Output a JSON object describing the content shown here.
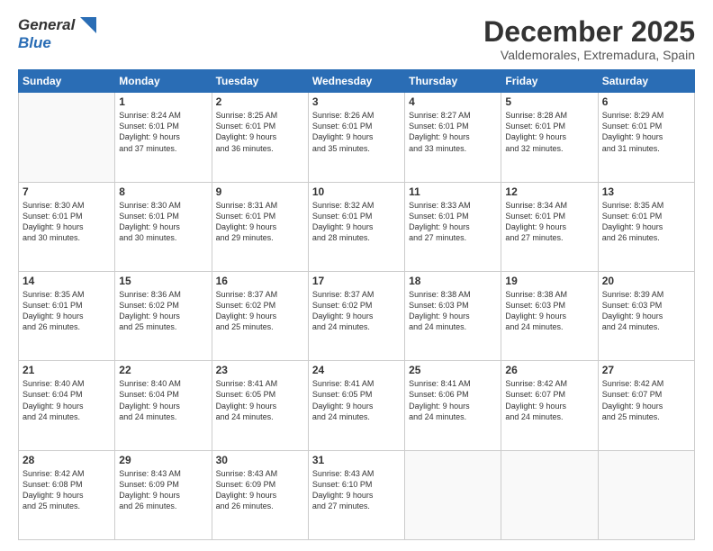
{
  "header": {
    "logo_general": "General",
    "logo_blue": "Blue",
    "month_title": "December 2025",
    "subtitle": "Valdemorales, Extremadura, Spain"
  },
  "days_of_week": [
    "Sunday",
    "Monday",
    "Tuesday",
    "Wednesday",
    "Thursday",
    "Friday",
    "Saturday"
  ],
  "weeks": [
    [
      {
        "day": "",
        "info": ""
      },
      {
        "day": "1",
        "info": "Sunrise: 8:24 AM\nSunset: 6:01 PM\nDaylight: 9 hours\nand 37 minutes."
      },
      {
        "day": "2",
        "info": "Sunrise: 8:25 AM\nSunset: 6:01 PM\nDaylight: 9 hours\nand 36 minutes."
      },
      {
        "day": "3",
        "info": "Sunrise: 8:26 AM\nSunset: 6:01 PM\nDaylight: 9 hours\nand 35 minutes."
      },
      {
        "day": "4",
        "info": "Sunrise: 8:27 AM\nSunset: 6:01 PM\nDaylight: 9 hours\nand 33 minutes."
      },
      {
        "day": "5",
        "info": "Sunrise: 8:28 AM\nSunset: 6:01 PM\nDaylight: 9 hours\nand 32 minutes."
      },
      {
        "day": "6",
        "info": "Sunrise: 8:29 AM\nSunset: 6:01 PM\nDaylight: 9 hours\nand 31 minutes."
      }
    ],
    [
      {
        "day": "7",
        "info": "Sunrise: 8:30 AM\nSunset: 6:01 PM\nDaylight: 9 hours\nand 30 minutes."
      },
      {
        "day": "8",
        "info": "Sunrise: 8:30 AM\nSunset: 6:01 PM\nDaylight: 9 hours\nand 30 minutes."
      },
      {
        "day": "9",
        "info": "Sunrise: 8:31 AM\nSunset: 6:01 PM\nDaylight: 9 hours\nand 29 minutes."
      },
      {
        "day": "10",
        "info": "Sunrise: 8:32 AM\nSunset: 6:01 PM\nDaylight: 9 hours\nand 28 minutes."
      },
      {
        "day": "11",
        "info": "Sunrise: 8:33 AM\nSunset: 6:01 PM\nDaylight: 9 hours\nand 27 minutes."
      },
      {
        "day": "12",
        "info": "Sunrise: 8:34 AM\nSunset: 6:01 PM\nDaylight: 9 hours\nand 27 minutes."
      },
      {
        "day": "13",
        "info": "Sunrise: 8:35 AM\nSunset: 6:01 PM\nDaylight: 9 hours\nand 26 minutes."
      }
    ],
    [
      {
        "day": "14",
        "info": "Sunrise: 8:35 AM\nSunset: 6:01 PM\nDaylight: 9 hours\nand 26 minutes."
      },
      {
        "day": "15",
        "info": "Sunrise: 8:36 AM\nSunset: 6:02 PM\nDaylight: 9 hours\nand 25 minutes."
      },
      {
        "day": "16",
        "info": "Sunrise: 8:37 AM\nSunset: 6:02 PM\nDaylight: 9 hours\nand 25 minutes."
      },
      {
        "day": "17",
        "info": "Sunrise: 8:37 AM\nSunset: 6:02 PM\nDaylight: 9 hours\nand 24 minutes."
      },
      {
        "day": "18",
        "info": "Sunrise: 8:38 AM\nSunset: 6:03 PM\nDaylight: 9 hours\nand 24 minutes."
      },
      {
        "day": "19",
        "info": "Sunrise: 8:38 AM\nSunset: 6:03 PM\nDaylight: 9 hours\nand 24 minutes."
      },
      {
        "day": "20",
        "info": "Sunrise: 8:39 AM\nSunset: 6:03 PM\nDaylight: 9 hours\nand 24 minutes."
      }
    ],
    [
      {
        "day": "21",
        "info": "Sunrise: 8:40 AM\nSunset: 6:04 PM\nDaylight: 9 hours\nand 24 minutes."
      },
      {
        "day": "22",
        "info": "Sunrise: 8:40 AM\nSunset: 6:04 PM\nDaylight: 9 hours\nand 24 minutes."
      },
      {
        "day": "23",
        "info": "Sunrise: 8:41 AM\nSunset: 6:05 PM\nDaylight: 9 hours\nand 24 minutes."
      },
      {
        "day": "24",
        "info": "Sunrise: 8:41 AM\nSunset: 6:05 PM\nDaylight: 9 hours\nand 24 minutes."
      },
      {
        "day": "25",
        "info": "Sunrise: 8:41 AM\nSunset: 6:06 PM\nDaylight: 9 hours\nand 24 minutes."
      },
      {
        "day": "26",
        "info": "Sunrise: 8:42 AM\nSunset: 6:07 PM\nDaylight: 9 hours\nand 24 minutes."
      },
      {
        "day": "27",
        "info": "Sunrise: 8:42 AM\nSunset: 6:07 PM\nDaylight: 9 hours\nand 25 minutes."
      }
    ],
    [
      {
        "day": "28",
        "info": "Sunrise: 8:42 AM\nSunset: 6:08 PM\nDaylight: 9 hours\nand 25 minutes."
      },
      {
        "day": "29",
        "info": "Sunrise: 8:43 AM\nSunset: 6:09 PM\nDaylight: 9 hours\nand 26 minutes."
      },
      {
        "day": "30",
        "info": "Sunrise: 8:43 AM\nSunset: 6:09 PM\nDaylight: 9 hours\nand 26 minutes."
      },
      {
        "day": "31",
        "info": "Sunrise: 8:43 AM\nSunset: 6:10 PM\nDaylight: 9 hours\nand 27 minutes."
      },
      {
        "day": "",
        "info": ""
      },
      {
        "day": "",
        "info": ""
      },
      {
        "day": "",
        "info": ""
      }
    ]
  ]
}
